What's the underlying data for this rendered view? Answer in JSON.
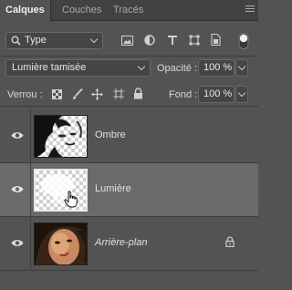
{
  "tabs": [
    {
      "label": "Calques",
      "active": true
    },
    {
      "label": "Couches",
      "active": false
    },
    {
      "label": "Tracés",
      "active": false
    }
  ],
  "filter": {
    "label": "Type"
  },
  "blend": {
    "mode": "Lumière tamisée",
    "opacity_label": "Opacité :",
    "opacity_value": "100 %"
  },
  "lock": {
    "label": "Verrou :",
    "fill_label": "Fond :",
    "fill_value": "100 %"
  },
  "layers": [
    {
      "name": "Ombre",
      "italic": false,
      "selected": false,
      "locked": false,
      "icon": "eye-icon"
    },
    {
      "name": "Lumière",
      "italic": false,
      "selected": true,
      "locked": false,
      "icon": "eye-icon"
    },
    {
      "name": "Arrière-plan",
      "italic": true,
      "selected": false,
      "locked": true,
      "icon": "eye-icon"
    }
  ],
  "colors": {
    "panel": "#535353",
    "tabbar": "#424242",
    "selected_row": "#6a6a6a"
  }
}
